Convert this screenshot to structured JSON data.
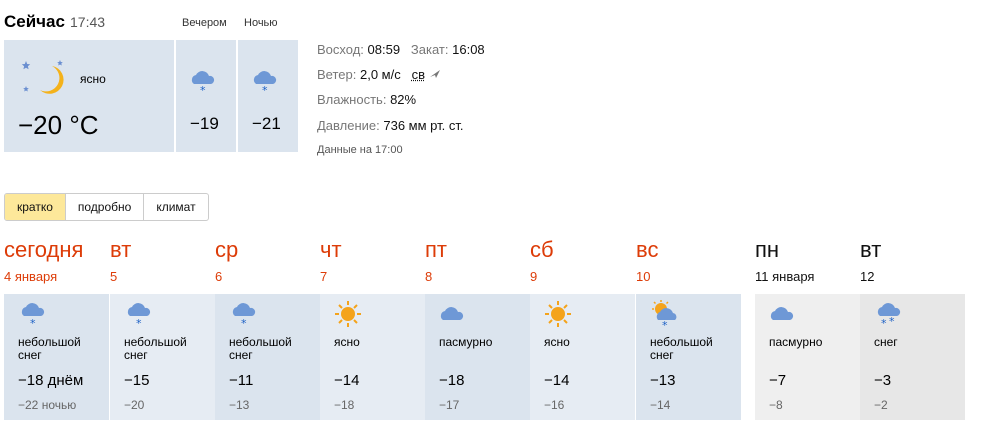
{
  "now": {
    "title": "Сейчас",
    "time": "17:43",
    "condition": "ясно",
    "temp": "−20 °C",
    "evening_label": "Вечером",
    "night_label": "Ночью",
    "evening_temp": "−19",
    "night_temp": "−21"
  },
  "details": {
    "sunrise_label": "Восход:",
    "sunrise": "08:59",
    "sunset_label": "Закат:",
    "sunset": "16:08",
    "wind_label": "Ветер:",
    "wind": "2,0 м/с",
    "wind_dir": "св",
    "humidity_label": "Влажность:",
    "humidity": "82%",
    "pressure_label": "Давление:",
    "pressure": "736 мм рт. ст.",
    "data_time": "Данные на 17:00"
  },
  "tabs": [
    "кратко",
    "подробно",
    "климат"
  ],
  "forecast": [
    {
      "name": "сегодня",
      "date": "4 января",
      "cond1": "небольшой",
      "cond2": "снег",
      "day": "−18 днём",
      "night": "−22 ночью",
      "icon": "snow-cloud-icon"
    },
    {
      "name": "вт",
      "date": "5",
      "cond1": "небольшой",
      "cond2": "снег",
      "day": "−15",
      "night": "−20",
      "icon": "snow-cloud-icon"
    },
    {
      "name": "ср",
      "date": "6",
      "cond1": "небольшой",
      "cond2": "снег",
      "day": "−11",
      "night": "−13",
      "icon": "snow-cloud-icon"
    },
    {
      "name": "чт",
      "date": "7",
      "cond1": "ясно",
      "cond2": "",
      "day": "−14",
      "night": "−18",
      "icon": "sun-icon"
    },
    {
      "name": "пт",
      "date": "8",
      "cond1": "пасмурно",
      "cond2": "",
      "day": "−18",
      "night": "−17",
      "icon": "cloud-icon"
    },
    {
      "name": "сб",
      "date": "9",
      "cond1": "ясно",
      "cond2": "",
      "day": "−14",
      "night": "−16",
      "icon": "sun-icon"
    },
    {
      "name": "вс",
      "date": "10",
      "cond1": "небольшой",
      "cond2": "снег",
      "day": "−13",
      "night": "−14",
      "icon": "sun-cloud-snow-icon"
    },
    {
      "name": "пн",
      "date": "11 января",
      "cond1": "пасмурно",
      "cond2": "",
      "day": "−7",
      "night": "−8",
      "icon": "cloud-icon"
    },
    {
      "name": "вт",
      "date": "12",
      "cond1": "снег",
      "cond2": "",
      "day": "−3",
      "night": "−2",
      "icon": "snow-heavy-icon"
    }
  ],
  "colors": {
    "accent_red": "#dd3c08",
    "card_bg": "#dbe4ee",
    "tab_active": "#fde89a"
  }
}
